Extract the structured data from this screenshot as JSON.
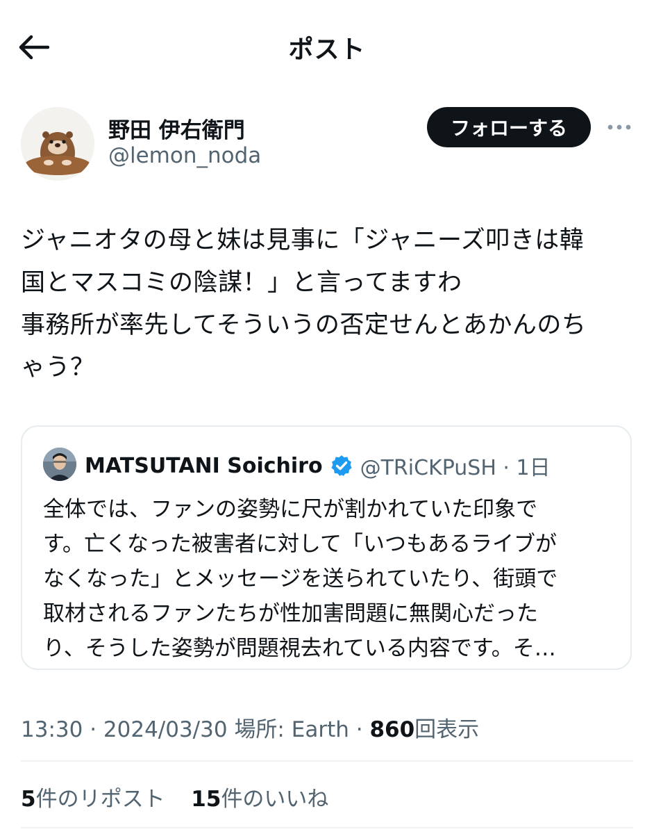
{
  "header": {
    "title": "ポスト"
  },
  "author": {
    "display_name": "野田 伊右衛門",
    "handle": "@lemon_noda",
    "follow_label": "フォローする"
  },
  "post": {
    "lines": [
      "ジャニオタの母と妹は見事に「ジャニーズ叩きは韓",
      "国とマスコミの陰謀！」と言ってますわ",
      "事務所が率先してそういうの否定せんとあかんのち",
      "ゃう？"
    ]
  },
  "quote": {
    "name": "MATSUTANI Soichiro",
    "handle_time": "@TRiCKPuSH · 1日",
    "lines": [
      "全体では、ファンの姿勢に尺が割かれていた印象で",
      "す。亡くなった被害者に対して「いつもあるライブが",
      "なくなった」とメッセージを送られていたり、街頭で",
      "取材されるファンたちが性加害問題に無関心だった",
      "り、そうした姿勢が問題視去れている内容です。そ…"
    ]
  },
  "meta": {
    "time_date": "13:30 · 2024/03/30",
    "location": "場所: Earth ·",
    "views_count": "860",
    "views_label": "回表示"
  },
  "stats": {
    "reposts_count": "5",
    "reposts_label": "件のリポスト",
    "likes_count": "15",
    "likes_label": "件のいいね"
  },
  "icons": {
    "back": "arrow-left-icon",
    "more": "more-horizontal-icon",
    "verified": "verified-badge-icon"
  },
  "colors": {
    "text": "#0f1419",
    "secondary": "#536471",
    "verified": "#1d9bf0",
    "follow_bg": "#0f1419",
    "border": "#e6ecf0"
  }
}
